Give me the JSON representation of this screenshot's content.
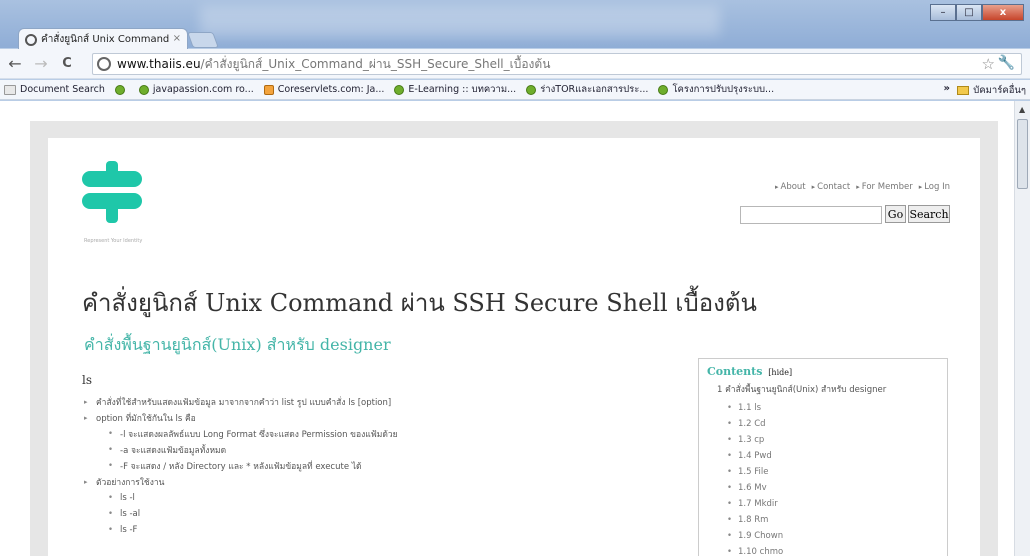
{
  "window": {
    "tab_title": "คำสั่งยูนิกส์ Unix Command ",
    "tab_close": "×",
    "min_label": "–",
    "max_label": "□",
    "close_label": "x"
  },
  "toolbar": {
    "back": "←",
    "forward": "→",
    "reload": "C",
    "url_domain": "www.thaiis.eu",
    "url_path": "/คำสั่งยูนิกส์_Unix_Command_ผ่าน_SSH_Secure_Shell_เบื้องต้น",
    "star": "☆",
    "wrench": "🔧"
  },
  "bookmarks": {
    "items": [
      {
        "label": "Document Search",
        "icon": "doc"
      },
      {
        "label": "",
        "icon": "green"
      },
      {
        "label": "javapassion.com ro...",
        "icon": "green"
      },
      {
        "label": "Coreservlets.com: Ja...",
        "icon": "cs"
      },
      {
        "label": "E-Learning :: บทความ...",
        "icon": "green"
      },
      {
        "label": "ร่างTORและเอกสารประ...",
        "icon": "green"
      },
      {
        "label": "โครงการปรับปรุงระบบ...",
        "icon": "green"
      }
    ],
    "more": "»",
    "other_folder": "บัคมาร์คอื่นๆ"
  },
  "site": {
    "tagline": "Represent Your Identity",
    "nav": [
      "About",
      "Contact",
      "For Member",
      "Log In"
    ],
    "go_label": "Go",
    "search_label": "Search",
    "search_value": ""
  },
  "article": {
    "title": "คำสั่งยูนิกส์ Unix Command ผ่าน SSH Secure Shell เบื้องต้น",
    "subtitle": "คำสั่งพื้นฐานยูนิกส์(Unix) สำหรับ designer",
    "section": "ls",
    "lines": [
      {
        "level": 1,
        "text": "คำสั่งที่ใช้สำหรับแสดงแฟ้มข้อมูล มาจากจากคำว่า list รูป แบบคำสั่ง ls [option]"
      },
      {
        "level": 1,
        "text": "option ที่มักใช้กันใน ls คือ"
      },
      {
        "level": 2,
        "text": "-l จะแสดงผลลัพธ์แบบ Long Format ซึ่งจะแสดง Permission ของแฟ้มด้วย"
      },
      {
        "level": 2,
        "text": "-a จะแสดงแฟ้มข้อมูลทั้งหมด"
      },
      {
        "level": 2,
        "text": "-F จะแสดง / หลัง Directory และ * หลังแฟ้มข้อมูลที่ execute ได้"
      },
      {
        "level": 1,
        "text": "ตัวอย่างการใช้งาน"
      },
      {
        "level": 2,
        "text": "ls -l"
      },
      {
        "level": 2,
        "text": "ls -al"
      },
      {
        "level": 2,
        "text": "ls -F"
      }
    ]
  },
  "toc": {
    "title": "Contents",
    "hide": "[hide]",
    "main": "1 คำสั่งพื้นฐานยูนิกส์(Unix) สำหรับ designer",
    "items": [
      "1.1 ls",
      "1.2 Cd",
      "1.3 cp",
      "1.4 Pwd",
      "1.5 File",
      "1.6 Mv",
      "1.7 Mkdir",
      "1.8 Rm",
      "1.9 Chown",
      "1.10 chmo"
    ]
  }
}
